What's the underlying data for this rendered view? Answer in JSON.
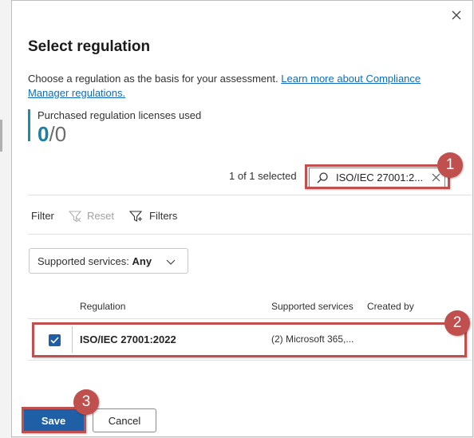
{
  "dialog": {
    "title": "Select regulation",
    "description": "Choose a regulation as the basis for your assessment.",
    "learn_more_link": "Learn more about Compliance Manager regulations."
  },
  "licenses": {
    "label": "Purchased regulation licenses used",
    "used": "0",
    "separator": "/",
    "total": "0"
  },
  "selection": {
    "count_text": "1 of 1 selected"
  },
  "search": {
    "value": "ISO/IEC 27001:2..."
  },
  "filters": {
    "label": "Filter",
    "reset_label": "Reset",
    "filters_label": "Filters"
  },
  "services_dropdown": {
    "label": "Supported services:",
    "value": "Any"
  },
  "table": {
    "columns": [
      "Regulation",
      "Supported services",
      "Created by"
    ],
    "rows": [
      {
        "regulation": "ISO/IEC 27001:2022",
        "services": "(2) Microsoft 365,...",
        "created_by": "",
        "selected": true
      }
    ]
  },
  "buttons": {
    "save_label": "Save",
    "cancel_label": "Cancel"
  },
  "callouts": [
    "1",
    "2",
    "3"
  ],
  "colors": {
    "accent": "#1f5fa6",
    "link": "#0f6cbd",
    "license_value": "#1b7fa0",
    "callout": "#c0504d"
  },
  "icons": [
    "close-icon",
    "search-icon",
    "clear-icon",
    "filter-reset-icon",
    "filter-icon",
    "chevron-down-icon",
    "checkmark-icon"
  ]
}
